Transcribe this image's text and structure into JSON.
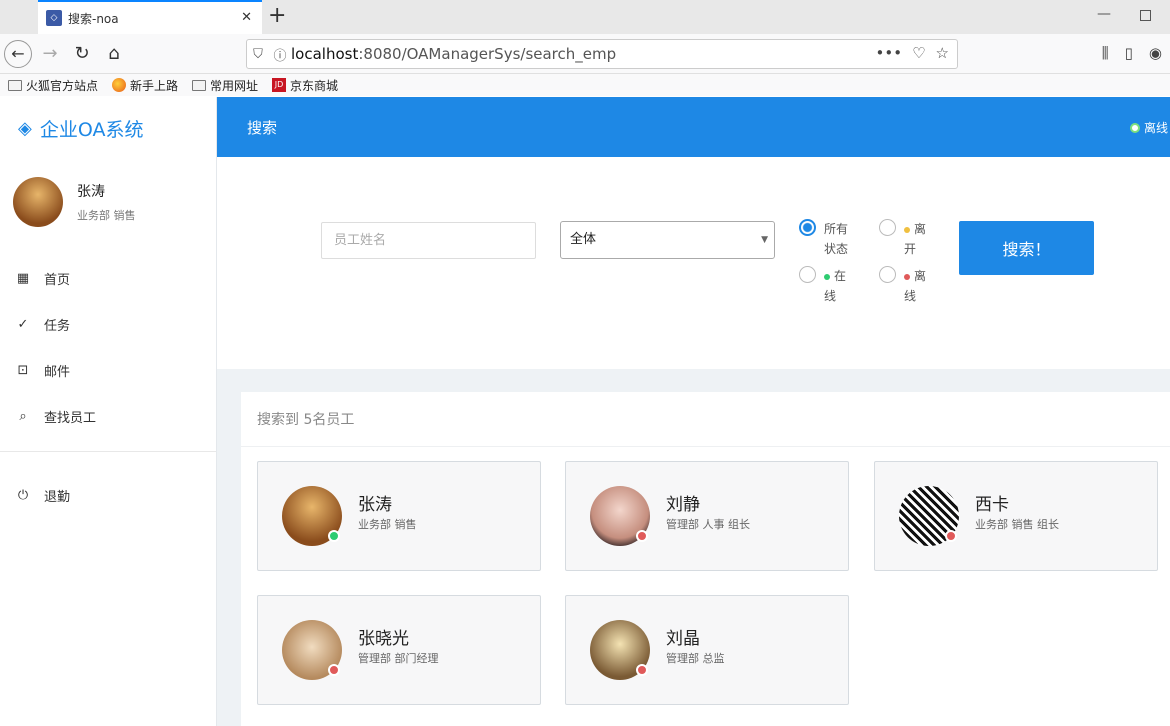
{
  "browser": {
    "tab_title": "搜索-noa",
    "url_host": "localhost",
    "url_path": ":8080/OAManagerSys/search_emp",
    "bookmarks": [
      "火狐官方站点",
      "新手上路",
      "常用网址",
      "京东商城"
    ]
  },
  "app": {
    "brand": "企业OA系统",
    "page_title": "搜索",
    "status": "离线",
    "accent_color": "#1e88e5"
  },
  "user": {
    "name": "张涛",
    "dept": "业务部 销售"
  },
  "menu": {
    "home": "首页",
    "tasks": "任务",
    "mail": "邮件",
    "find": "查找员工",
    "logout": "退勤"
  },
  "search": {
    "name_placeholder": "员工姓名",
    "dept_selected": "全体",
    "radio_all": "所有状态",
    "radio_away": "离开",
    "radio_online": "在线",
    "radio_offline": "离线",
    "button": "搜索！"
  },
  "results": {
    "summary": "搜索到 5名员工",
    "employees": [
      {
        "name": "张涛",
        "dept": "业务部 销售",
        "status": "online"
      },
      {
        "name": "刘静",
        "dept": "管理部 人事 组长",
        "status": "offline"
      },
      {
        "name": "西卡",
        "dept": "业务部 销售 组长",
        "status": "offline"
      },
      {
        "name": "张晓光",
        "dept": "管理部 部门经理",
        "status": "offline"
      },
      {
        "name": "刘晶",
        "dept": "管理部 总监",
        "status": "offline"
      }
    ]
  },
  "colors": {
    "online": "#2ecc71",
    "offline": "#e05a5a",
    "away": "#f0c040"
  }
}
